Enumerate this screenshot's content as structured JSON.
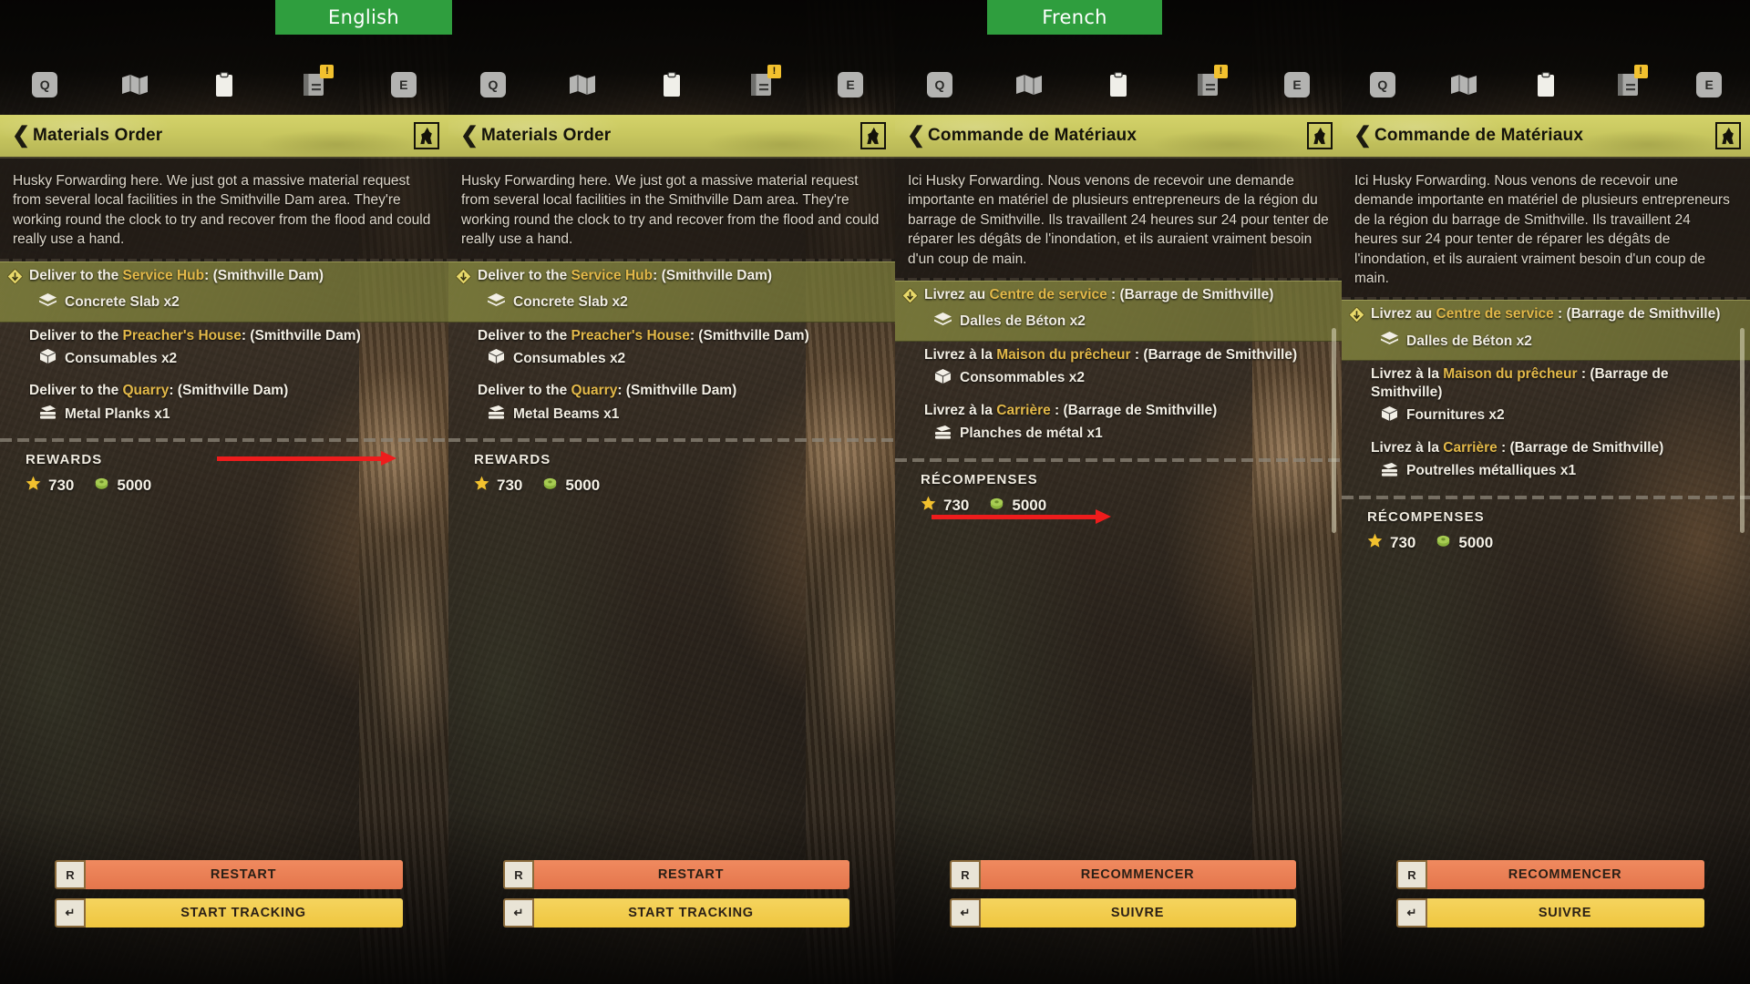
{
  "tabs": [
    {
      "id": "english",
      "label": "English"
    },
    {
      "id": "french",
      "label": "French"
    }
  ],
  "colors": {
    "tab_green": "#2f9e3e",
    "title_yellow": "#c8c75f",
    "highlight_olive": "#7d7e3c",
    "location_gold": "#e3b949",
    "restart_orange": "#e4764c",
    "track_yellow": "#efc63f",
    "arrow_red": "#ee1c1c",
    "star_gold": "#f2c12e",
    "cash_green": "#8ab23c"
  },
  "hud": {
    "icons": [
      {
        "name": "key-q",
        "label": "Q",
        "type": "keycap"
      },
      {
        "name": "map-icon",
        "label": "",
        "type": "map"
      },
      {
        "name": "clipboard-icon",
        "label": "",
        "type": "clipboard"
      },
      {
        "name": "journal-icon",
        "label": "",
        "type": "journal",
        "badge": "!"
      },
      {
        "name": "key-e",
        "label": "E",
        "type": "keycap"
      }
    ]
  },
  "panels": [
    {
      "id": "panel-1-english-before",
      "language": "English",
      "title": "Materials Order",
      "description": "Husky Forwarding here. We just got a massive material request from several local facilities in the Smithville Dam area. They're working round the clock to try and recover from the flood and could really use a hand.",
      "objectives": [
        {
          "active": true,
          "prefix": "Deliver to the ",
          "location": "Service Hub",
          "suffix": ": (Smithville Dam)",
          "items": [
            {
              "icon": "slab-icon",
              "name": "Concrete Slab x2"
            }
          ]
        },
        {
          "active": false,
          "prefix": "Deliver to the ",
          "location": "Preacher's House",
          "suffix": ": (Smithville Dam)",
          "items": [
            {
              "icon": "box-icon",
              "name": "Consumables x2"
            }
          ]
        },
        {
          "active": false,
          "prefix": "Deliver to the ",
          "location": "Quarry",
          "suffix": ": (Smithville Dam)",
          "items": [
            {
              "icon": "planks-icon",
              "name": "Metal Planks x1"
            }
          ]
        }
      ],
      "rewards_label": "REWARDS",
      "rewards": [
        {
          "icon": "star-icon",
          "value": "730"
        },
        {
          "icon": "cash-icon",
          "value": "5000"
        }
      ],
      "buttons": [
        {
          "name": "restart-button",
          "key": "R",
          "label": "RESTART"
        },
        {
          "name": "start-tracking-button",
          "key": "↵",
          "label": "START TRACKING"
        }
      ]
    },
    {
      "id": "panel-2-english-after",
      "language": "English",
      "title": "Materials Order",
      "description": "Husky Forwarding here. We just got a massive material request from several local facilities in the Smithville Dam area. They're working round the clock to try and recover from the flood and could really use a hand.",
      "objectives": [
        {
          "active": true,
          "prefix": "Deliver to the ",
          "location": "Service Hub",
          "suffix": ": (Smithville Dam)",
          "items": [
            {
              "icon": "slab-icon",
              "name": "Concrete Slab x2"
            }
          ]
        },
        {
          "active": false,
          "prefix": "Deliver to the ",
          "location": "Preacher's House",
          "suffix": ": (Smithville Dam)",
          "items": [
            {
              "icon": "box-icon",
              "name": "Consumables x2"
            }
          ]
        },
        {
          "active": false,
          "prefix": "Deliver to the ",
          "location": "Quarry",
          "suffix": ": (Smithville Dam)",
          "items": [
            {
              "icon": "planks-icon",
              "name": "Metal Beams x1"
            }
          ]
        }
      ],
      "rewards_label": "REWARDS",
      "rewards": [
        {
          "icon": "star-icon",
          "value": "730"
        },
        {
          "icon": "cash-icon",
          "value": "5000"
        }
      ],
      "buttons": [
        {
          "name": "restart-button",
          "key": "R",
          "label": "RESTART"
        },
        {
          "name": "start-tracking-button",
          "key": "↵",
          "label": "START TRACKING"
        }
      ]
    },
    {
      "id": "panel-3-french-before",
      "language": "French",
      "title": "Commande de Matériaux",
      "description": "Ici Husky Forwarding. Nous venons de recevoir une demande importante en matériel de plusieurs entrepreneurs de la région du barrage de Smithville. Ils travaillent 24 heures sur 24 pour tenter de réparer les dégâts de l'inondation, et ils auraient vraiment besoin d'un coup de main.",
      "objectives": [
        {
          "active": true,
          "prefix": "Livrez au ",
          "location": "Centre de service",
          "suffix": " : (Barrage de Smithville)",
          "items": [
            {
              "icon": "slab-icon",
              "name": "Dalles de Béton x2"
            }
          ]
        },
        {
          "active": false,
          "prefix": "Livrez à la ",
          "location": "Maison du prêcheur",
          "suffix": " : (Barrage de Smithville)",
          "items": [
            {
              "icon": "box-icon",
              "name": "Consommables x2"
            }
          ]
        },
        {
          "active": false,
          "prefix": "Livrez à la ",
          "location": "Carrière",
          "suffix": " : (Barrage de Smithville)",
          "items": [
            {
              "icon": "planks-icon",
              "name": "Planches de métal x1"
            }
          ]
        }
      ],
      "rewards_label": "RÉCOMPENSES",
      "rewards": [
        {
          "icon": "star-icon",
          "value": "730"
        },
        {
          "icon": "cash-icon",
          "value": "5000"
        }
      ],
      "buttons": [
        {
          "name": "restart-button",
          "key": "R",
          "label": "RECOMMENCER"
        },
        {
          "name": "start-tracking-button",
          "key": "↵",
          "label": "SUIVRE"
        }
      ]
    },
    {
      "id": "panel-4-french-after",
      "language": "French",
      "title": "Commande de Matériaux",
      "description": "Ici Husky Forwarding. Nous venons de recevoir une demande importante en matériel de plusieurs entrepreneurs de la région du barrage de Smithville. Ils travaillent 24 heures sur 24 pour tenter de réparer les dégâts de l'inondation, et ils auraient vraiment besoin d'un coup de main.",
      "objectives": [
        {
          "active": true,
          "prefix": "Livrez au ",
          "location": "Centre de service",
          "suffix": " : (Barrage de Smithville)",
          "items": [
            {
              "icon": "slab-icon",
              "name": "Dalles de Béton x2"
            }
          ]
        },
        {
          "active": false,
          "prefix": "Livrez à la ",
          "location": "Maison du prêcheur",
          "suffix": " : (Barrage de Smithville)",
          "items": [
            {
              "icon": "box-icon",
              "name": "Fournitures x2"
            }
          ]
        },
        {
          "active": false,
          "prefix": "Livrez à la ",
          "location": "Carrière",
          "suffix": " : (Barrage de Smithville)",
          "items": [
            {
              "icon": "planks-icon",
              "name": "Poutrelles métalliques x1"
            }
          ]
        }
      ],
      "rewards_label": "RÉCOMPENSES",
      "rewards": [
        {
          "icon": "star-icon",
          "value": "730"
        },
        {
          "icon": "cash-icon",
          "value": "5000"
        }
      ],
      "buttons": [
        {
          "name": "restart-button",
          "key": "R",
          "label": "RECOMMENCER"
        },
        {
          "name": "start-tracking-button",
          "key": "↵",
          "label": "SUIVRE"
        }
      ]
    }
  ],
  "annotations": [
    {
      "name": "arrow-english-change",
      "from_item": "Metal Planks x1",
      "to_item": "Metal Beams x1"
    },
    {
      "name": "arrow-french-change",
      "from_item": "Planches de métal x1",
      "to_item": "Poutrelles métalliques x1"
    }
  ]
}
